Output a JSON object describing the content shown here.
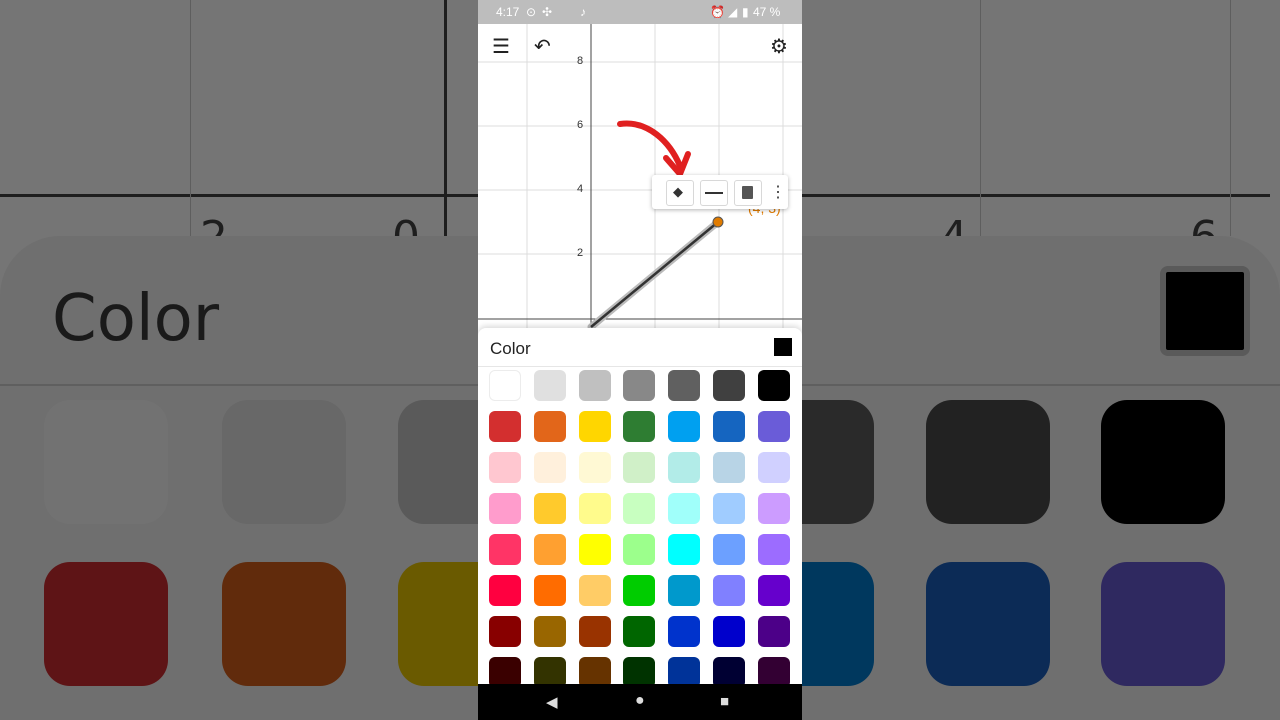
{
  "status_bar": {
    "time": "4:17",
    "battery": "47 %",
    "icons": [
      "location-icon",
      "fan-icon",
      "mic-icon",
      "alarm-icon",
      "signal-icon",
      "battery-icon"
    ]
  },
  "toolbar": {
    "menu_icon": "menu-icon",
    "undo_icon": "undo-icon",
    "settings_icon": "gear-icon"
  },
  "graph": {
    "y_ticks": [
      "8",
      "6",
      "4",
      "2",
      "0"
    ],
    "x_ticks": [
      "2",
      "2",
      "4",
      "6"
    ],
    "segment_end_point": "(4, 3)",
    "point_color": "#e07b00"
  },
  "context_menu": {
    "items": [
      "fill-color-icon",
      "line-style-icon",
      "delete-icon",
      "more-vert-icon"
    ]
  },
  "color_panel": {
    "title": "Color",
    "selected_color": "#000000",
    "rows": [
      [
        "#ffffff",
        "#e0e0e0",
        "#c0c0c0",
        "#888888",
        "#606060",
        "#404040",
        "#000000"
      ],
      [
        "#d32f2f",
        "#e2661a",
        "#ffd600",
        "#2e7d32",
        "#00a0f0",
        "#1565c0",
        "#6a5cd8"
      ],
      [
        "#ffc7d0",
        "#fff0dc",
        "#fff9d4",
        "#d0f0c8",
        "#b2ece8",
        "#b8d4e6",
        "#d0d0ff"
      ],
      [
        "#ff9ccc",
        "#ffca2c",
        "#fffb8c",
        "#c8ffc0",
        "#a0fffa",
        "#a0ccff",
        "#cc9cff"
      ],
      [
        "#ff3466",
        "#ffa030",
        "#ffff00",
        "#9cff8c",
        "#00ffff",
        "#6ca0ff",
        "#9c6cff"
      ],
      [
        "#ff0040",
        "#ff6c00",
        "#ffcc66",
        "#00cc00",
        "#0099cc",
        "#8080ff",
        "#6600cc"
      ],
      [
        "#880000",
        "#996600",
        "#993300",
        "#006600",
        "#0033cc",
        "#0000cc",
        "#4c0088"
      ],
      [
        "#3a0000",
        "#333300",
        "#663300",
        "#003300",
        "#003399",
        "#000033",
        "#330033"
      ]
    ]
  },
  "navigation": {
    "back": "back-icon",
    "home": "home-icon",
    "recents": "recents-icon"
  },
  "background": {
    "title": "Color",
    "numbers": [
      "2",
      "0",
      "4",
      "6"
    ]
  }
}
